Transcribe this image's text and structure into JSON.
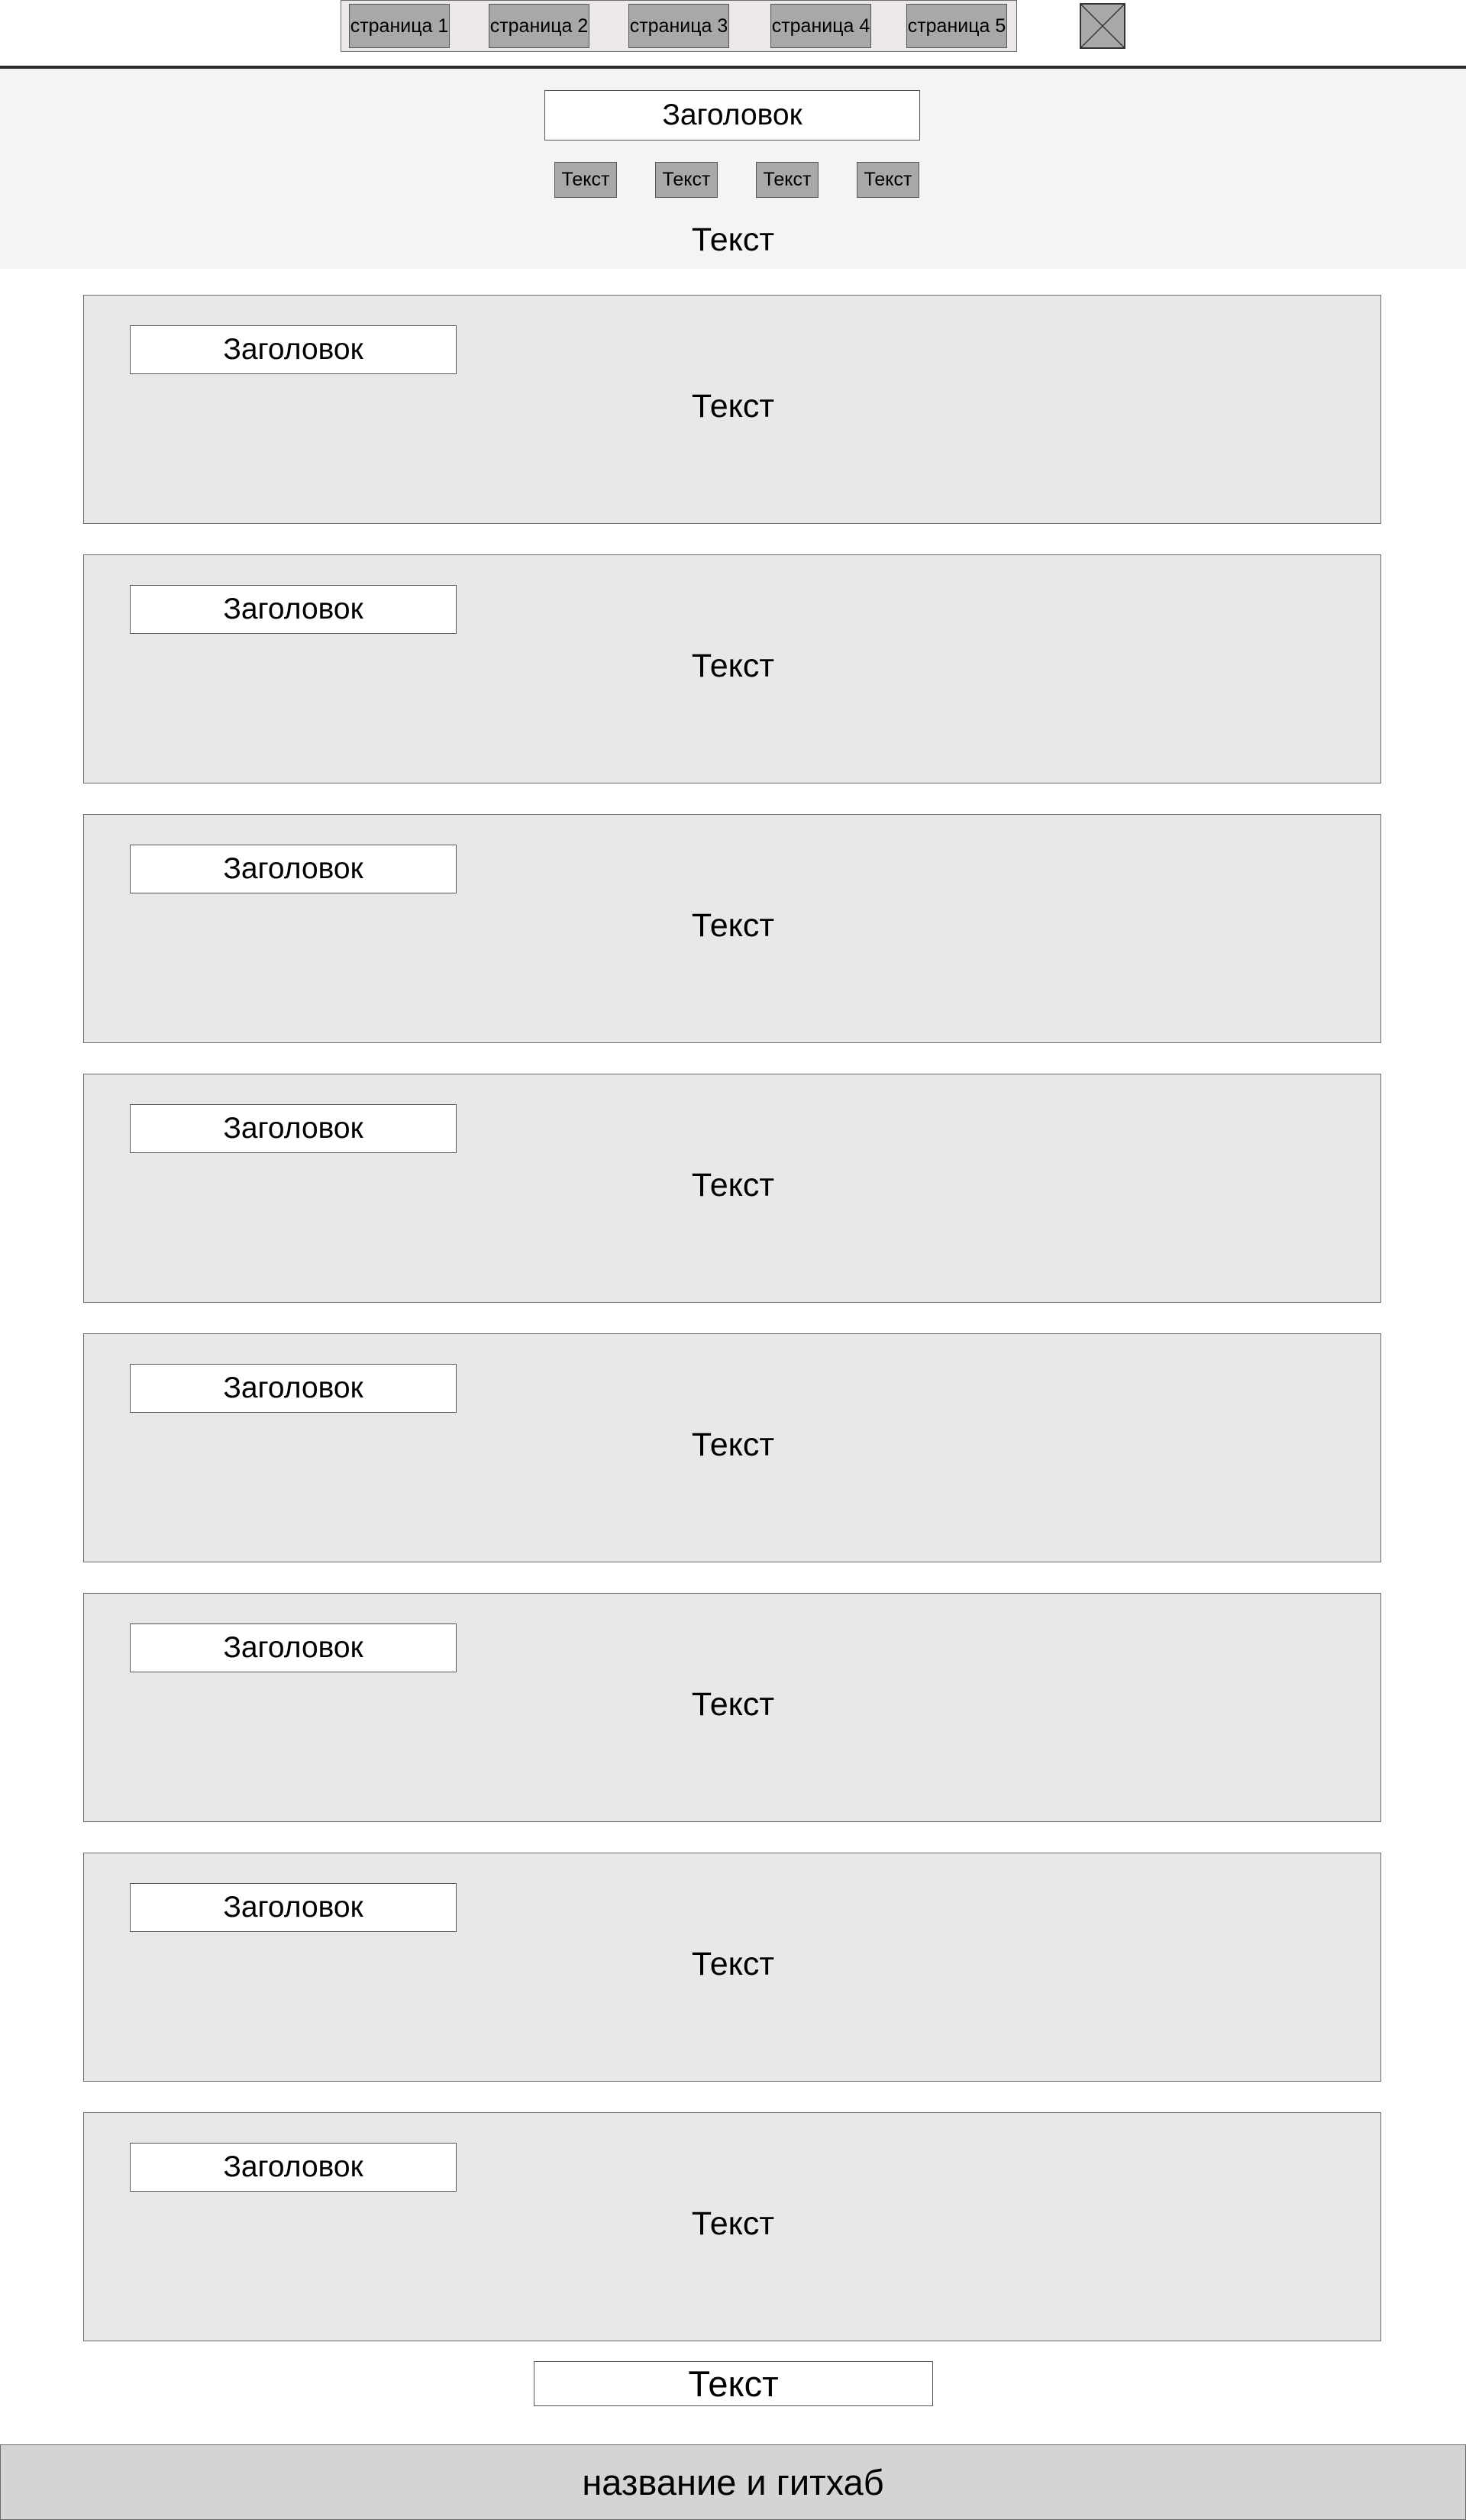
{
  "nav": {
    "pages": [
      {
        "label": "страница 1"
      },
      {
        "label": "страница 2"
      },
      {
        "label": "страница 3"
      },
      {
        "label": "страница 4"
      },
      {
        "label": "страница 5"
      }
    ],
    "logo_icon": "image-placeholder-icon"
  },
  "hero": {
    "title": "Заголовок",
    "buttons": [
      {
        "label": "Текст"
      },
      {
        "label": "Текст"
      },
      {
        "label": "Текст"
      },
      {
        "label": "Текст"
      }
    ],
    "text": "Текст"
  },
  "cards": [
    {
      "title": "Заголовок",
      "text": "Текст"
    },
    {
      "title": "Заголовок",
      "text": "Текст"
    },
    {
      "title": "Заголовок",
      "text": "Текст"
    },
    {
      "title": "Заголовок",
      "text": "Текст"
    },
    {
      "title": "Заголовок",
      "text": "Текст"
    },
    {
      "title": "Заголовок",
      "text": "Текст"
    },
    {
      "title": "Заголовок",
      "text": "Текст"
    },
    {
      "title": "Заголовок",
      "text": "Текст"
    }
  ],
  "bottom_text": "Текст",
  "footer": {
    "label": "название и гитхаб"
  },
  "colors": {
    "button_fill": "#a8a8a8",
    "hero_background": "#f4f4f4",
    "card_background": "#e8e8e8",
    "footer_background": "#d4d4d4"
  }
}
